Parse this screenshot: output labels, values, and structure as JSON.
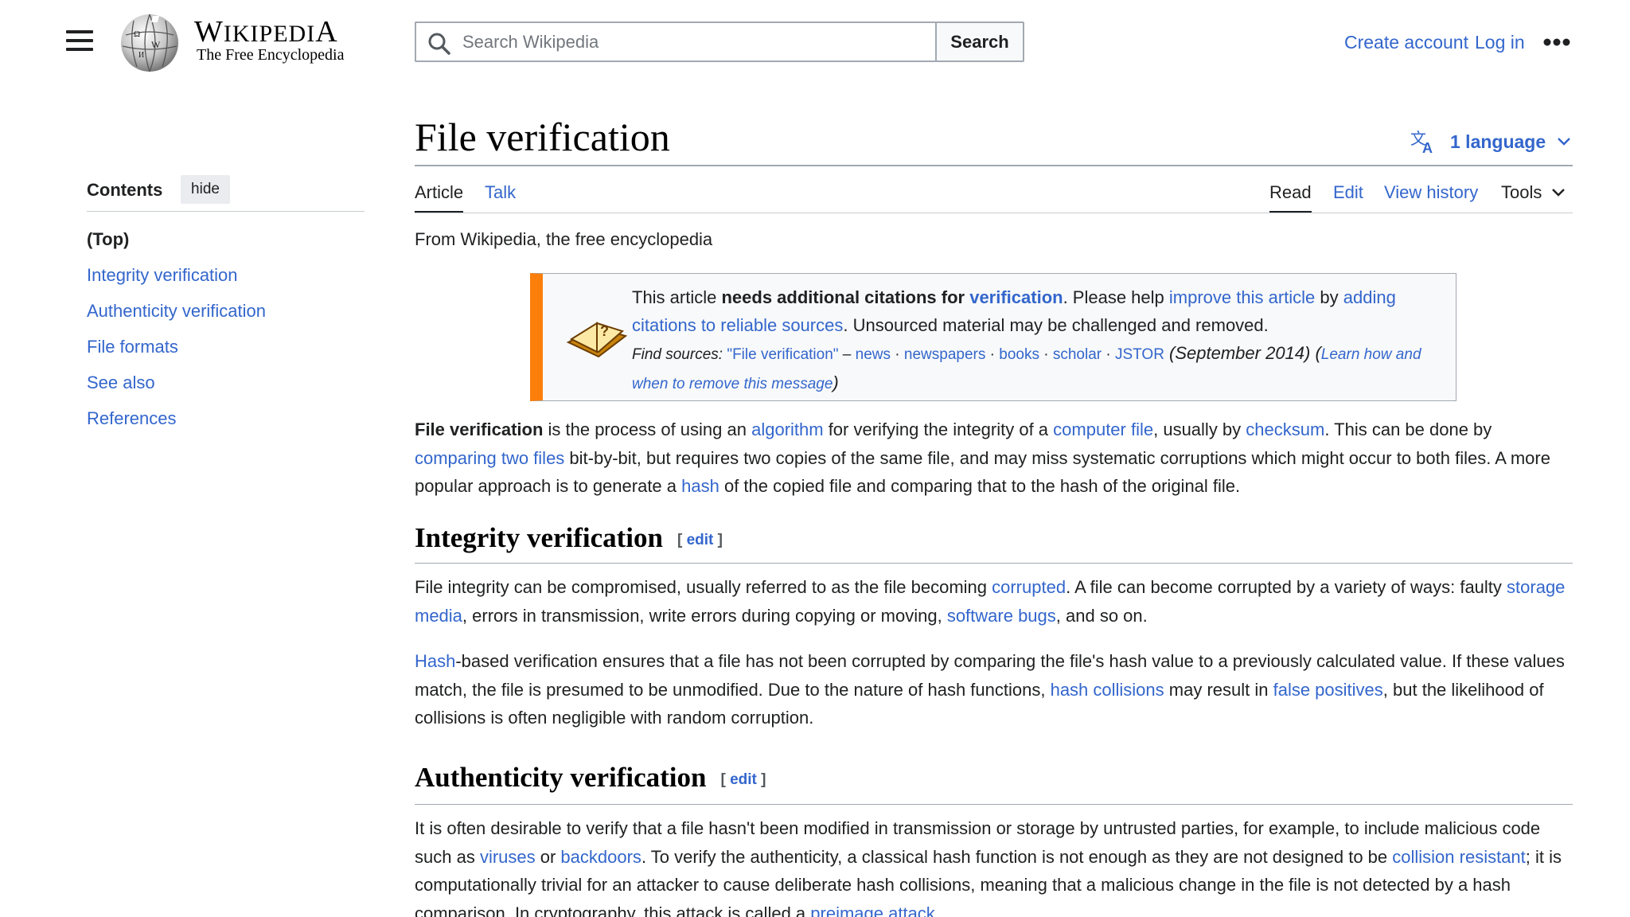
{
  "header": {
    "wordmark_big1": "W",
    "wordmark_small1": "IKIPEDI",
    "wordmark_big2": "A",
    "tagline": "The Free Encyclopedia",
    "search_placeholder": "Search Wikipedia",
    "search_button": "Search",
    "create_account": "Create account",
    "login": "Log in"
  },
  "toc": {
    "title": "Contents",
    "hide": "hide",
    "items": [
      "(Top)",
      "Integrity verification",
      "Authenticity verification",
      "File formats",
      "See also",
      "References"
    ]
  },
  "page": {
    "title": "File verification",
    "languages": "1 language",
    "tabs": {
      "article": "Article",
      "talk": "Talk",
      "read": "Read",
      "edit": "Edit",
      "history": "View history",
      "tools": "Tools"
    },
    "from": "From Wikipedia, the free encyclopedia"
  },
  "ambox": {
    "t1": "This article ",
    "t2": "needs additional citations for ",
    "t3": "verification",
    "t4": ". Please help ",
    "t5": "improve this article",
    "t6": " by ",
    "t7": "adding citations to reliable sources",
    "t8": ". Unsourced material may be challenged and removed.",
    "find_label": "Find sources: ",
    "find_query": "\"File verification\"",
    "find_dash": " – ",
    "src_news": "news",
    "src_newspapers": "newspapers",
    "src_books": "books",
    "src_scholar": "scholar",
    "src_jstor": "JSTOR",
    "sep": " · ",
    "date": " (September 2014) (",
    "learn": "Learn how and when to remove this message",
    "close": ")"
  },
  "intro": {
    "b": "File verification",
    "s1": " is the process of using an ",
    "l1": "algorithm",
    "s2": " for verifying the integrity of a ",
    "l2": "computer file",
    "s3": ", usually by ",
    "l3": "checksum",
    "s4": ". This can be done by ",
    "l4": "comparing two files",
    "s5": " bit-by-bit, but requires two copies of the same file, and may miss systematic corruptions which might occur to both files. A more popular approach is to generate a ",
    "l5": "hash",
    "s6": " of the copied file and comparing that to the hash of the original file."
  },
  "sec_integrity": {
    "heading": "Integrity verification",
    "edit_open": "[ ",
    "edit": "edit",
    "edit_close": " ]",
    "p1": {
      "s1": "File integrity can be compromised, usually referred to as the file becoming ",
      "l1": "corrupted",
      "s2": ". A file can become corrupted by a variety of ways: faulty ",
      "l2": "storage media",
      "s3": ", errors in transmission, write errors during copying or moving, ",
      "l3": "software bugs",
      "s4": ", and so on."
    },
    "p2": {
      "l1": "Hash",
      "s1": "-based verification ensures that a file has not been corrupted by comparing the file's hash value to a previously calculated value. If these values match, the file is presumed to be unmodified. Due to the nature of hash functions, ",
      "l2": "hash collisions",
      "s2": " may result in ",
      "l3": "false positives",
      "s3": ", but the likelihood of collisions is often negligible with random corruption."
    }
  },
  "sec_auth": {
    "heading": "Authenticity verification",
    "edit_open": "[ ",
    "edit": "edit",
    "edit_close": " ]",
    "p1": {
      "s1": "It is often desirable to verify that a file hasn't been modified in transmission or storage by untrusted parties, for example, to include malicious code such as ",
      "l1": "viruses",
      "s2": " or ",
      "l2": "backdoors",
      "s3": ". To verify the authenticity, a classical hash function is not enough as they are not designed to be ",
      "l3": "collision resistant",
      "s4": "; it is computationally trivial for an attacker to cause deliberate hash collisions, meaning that a malicious change in the file is not detected by a hash comparison. In cryptography, this attack is called a ",
      "l4": "preimage attack",
      "s5": "."
    }
  },
  "colors": {
    "link": "#3366cc",
    "text": "#202122",
    "ambox_bar": "#fc7f0b",
    "rule": "#a2a9b1"
  },
  "icons": {
    "menu": "hamburger-menu-icon",
    "logo": "wikipedia-globe-logo",
    "search": "magnifier-icon",
    "more": "ellipsis-icon",
    "language": "translate-icon",
    "chevron": "chevron-down-icon",
    "ambox": "open-book-question-icon"
  }
}
